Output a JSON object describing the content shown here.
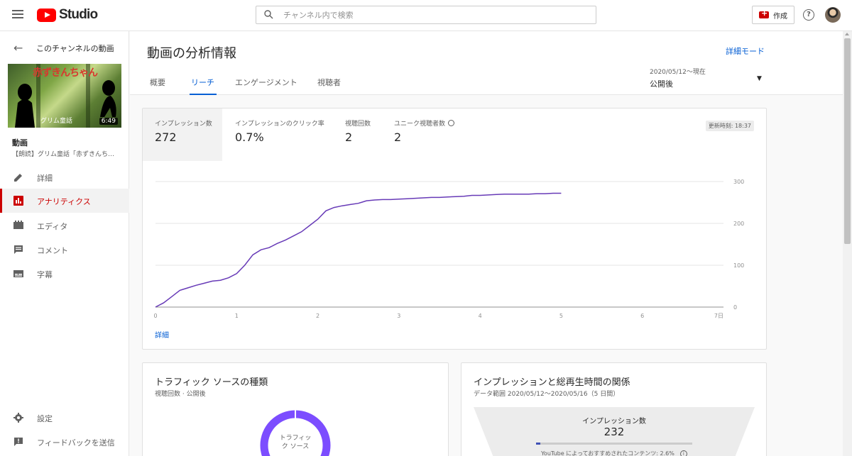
{
  "topbar": {
    "logo_text": "Studio",
    "search_placeholder": "チャンネル内で検索",
    "create_label": "作成",
    "help_label": "?"
  },
  "sidebar": {
    "back_label": "このチャンネルの動画",
    "thumb_title": "赤ずきんちゃん",
    "thumb_sub": "グリム童話",
    "thumb_duration": "6:49",
    "video_heading": "動画",
    "video_title": "【朗読】グリム童話「赤ずきんちゃん」",
    "items": [
      {
        "label": "詳細",
        "icon": "pencil-icon"
      },
      {
        "label": "アナリティクス",
        "icon": "analytics-icon",
        "active": true
      },
      {
        "label": "エディタ",
        "icon": "film-icon"
      },
      {
        "label": "コメント",
        "icon": "comment-icon"
      },
      {
        "label": "字幕",
        "icon": "subtitles-icon"
      }
    ],
    "bottom_items": [
      {
        "label": "設定",
        "icon": "gear-icon"
      },
      {
        "label": "フィードバックを送信",
        "icon": "feedback-icon"
      }
    ]
  },
  "header": {
    "title": "動画の分析情報",
    "advanced_mode": "詳細モード",
    "tabs": [
      {
        "label": "概要"
      },
      {
        "label": "リーチ",
        "active": true
      },
      {
        "label": "エンゲージメント"
      },
      {
        "label": "視聴者"
      }
    ],
    "date_range": "2020/05/12〜現在",
    "date_select": "公開後"
  },
  "reach_card": {
    "metrics": [
      {
        "label": "インプレッション数",
        "value": "272"
      },
      {
        "label": "インプレッションのクリック率",
        "value": "0.7%"
      },
      {
        "label": "視聴回数",
        "value": "2"
      },
      {
        "label": "ユニーク視聴者数",
        "value": "2"
      }
    ],
    "updated": "更新時刻: 18:37",
    "detail_link": "詳細"
  },
  "chart_data": {
    "type": "line",
    "x": [
      0,
      0.1,
      0.2,
      0.3,
      0.4,
      0.5,
      0.6,
      0.7,
      0.8,
      0.9,
      1.0,
      1.1,
      1.2,
      1.3,
      1.4,
      1.5,
      1.6,
      1.7,
      1.8,
      1.9,
      2.0,
      2.1,
      2.2,
      2.3,
      2.4,
      2.5,
      2.6,
      2.7,
      2.8,
      2.9,
      3.0,
      3.1,
      3.2,
      3.3,
      3.4,
      3.5,
      3.6,
      3.7,
      3.8,
      3.9,
      4.0,
      4.1,
      4.2,
      4.3,
      4.4,
      4.5,
      4.6,
      4.7,
      4.8,
      4.9,
      5.0
    ],
    "y": [
      0,
      10,
      25,
      40,
      46,
      52,
      57,
      62,
      64,
      70,
      80,
      100,
      125,
      137,
      142,
      152,
      160,
      170,
      180,
      195,
      210,
      230,
      238,
      242,
      245,
      248,
      254,
      256,
      257,
      257,
      258,
      259,
      260,
      261,
      262,
      262,
      263,
      264,
      265,
      267,
      267,
      268,
      269,
      270,
      270,
      270,
      270,
      271,
      271,
      272,
      272
    ],
    "xlim": [
      0,
      7
    ],
    "ylim": [
      0,
      300
    ],
    "x_ticks": [
      "0",
      "1",
      "2",
      "3",
      "4",
      "5",
      "6",
      "7日"
    ],
    "y_ticks": [
      "0",
      "100",
      "200",
      "300"
    ],
    "grid": true,
    "line_color": "#673ab7"
  },
  "traffic_card": {
    "title": "トラフィック ソースの種類",
    "subtitle": "視聴回数 · 公開後",
    "donut_label": "トラフィック ソース",
    "donut_color": "#7c4dff"
  },
  "funnel_card": {
    "title": "インプレッションと総再生時間の関係",
    "subtitle": "データ範囲 2020/05/12〜2020/05/16（5 日間）",
    "impressions_label": "インプレッション数",
    "impressions_value": "232",
    "note": "YouTube によっておすすめされたコンテンツ: 2.6%",
    "progress_fraction": 0.026
  }
}
